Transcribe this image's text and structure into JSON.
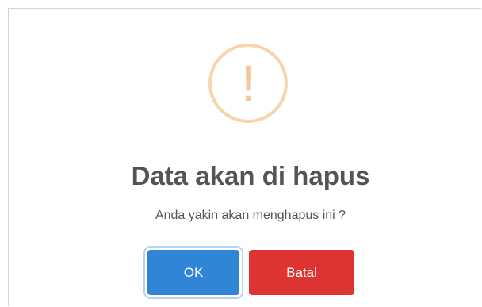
{
  "dialog": {
    "icon": "warning-exclamation-icon",
    "icon_glyph": "!",
    "title": "Data akan di hapus",
    "message": "Anda yakin akan menghapus ini ?",
    "confirm_label": "OK",
    "cancel_label": "Batal"
  },
  "colors": {
    "icon_ring": "#f8d4ac",
    "icon_glyph": "#f7c79a",
    "text": "#545454",
    "confirm_button": "#3085d6",
    "cancel_button": "#dd3333"
  }
}
